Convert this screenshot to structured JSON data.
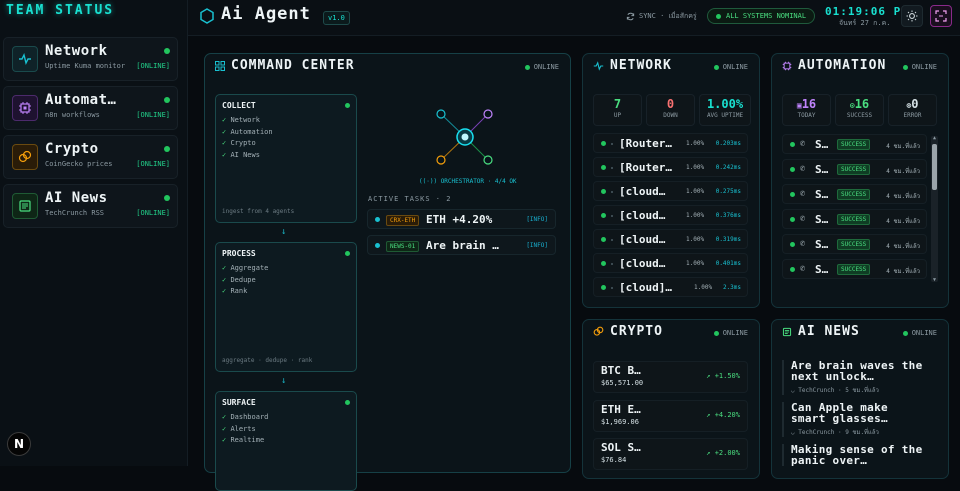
{
  "sidebar": {
    "title": "TEAM STATUS",
    "agents": [
      {
        "name": "Network",
        "sub": "Uptime Kuma monitor",
        "status": "[ONLINE]",
        "icon": "pulse-icon",
        "color": "#19b0c0"
      },
      {
        "name": "Automat…",
        "sub": "n8n workflows",
        "status": "[ONLINE]",
        "icon": "chip-icon",
        "color": "#a855f7"
      },
      {
        "name": "Crypto",
        "sub": "CoinGecko prices",
        "status": "[ONLINE]",
        "icon": "coins-icon",
        "color": "#f59e0b"
      },
      {
        "name": "AI News",
        "sub": "TechCrunch RSS",
        "status": "[ONLINE]",
        "icon": "newspaper-icon",
        "color": "#22c55e"
      }
    ],
    "footer_letter": "N"
  },
  "header": {
    "title": "Ai Agent",
    "version": "v1.0",
    "sync": "SYNC · เมื่อสักครู่",
    "system": "ALL SYSTEMS NOMINAL",
    "time": "01:19:06 PM",
    "date": "จันทร์ 27 ก.ค."
  },
  "command": {
    "title": "COMMAND CENTER",
    "status": "ONLINE",
    "stages": [
      {
        "title": "COLLECT",
        "items": [
          "Network",
          "Automation",
          "Crypto",
          "AI News"
        ],
        "footer": "ingest from 4 agents"
      },
      {
        "title": "PROCESS",
        "items": [
          "Aggregate",
          "Dedupe",
          "Rank"
        ],
        "footer": "aggregate · dedupe · rank"
      },
      {
        "title": "SURFACE",
        "items": [
          "Dashboard",
          "Alerts",
          "Realtime"
        ],
        "footer": ""
      }
    ],
    "orchestrator": "ORCHESTRATOR · 4/4 OK",
    "active_label": "ACTIVE TASKS · 2",
    "tasks": [
      {
        "tag": "CRX-ETH",
        "name": "ETH +4.20%",
        "info": "[INFO]",
        "tag_color": "#f59e0b"
      },
      {
        "tag": "NEWS-01",
        "name": "Are brain …",
        "info": "[INFO]",
        "tag_color": "#22c55e"
      }
    ]
  },
  "network": {
    "title": "NETWORK",
    "status": "ONLINE",
    "stats": [
      {
        "value": "7",
        "label": "UP",
        "color": "#4ade80"
      },
      {
        "value": "0",
        "label": "DOWN",
        "color": "#f87171"
      },
      {
        "value": "1.00%",
        "label": "AVG UPTIME",
        "color": "#19e0d0"
      }
    ],
    "rows": [
      {
        "name": "[Router…",
        "uptime": "1.00%",
        "ms": "0.203ms"
      },
      {
        "name": "[Router…",
        "uptime": "1.00%",
        "ms": "0.242ms"
      },
      {
        "name": "[cloud…",
        "uptime": "1.00%",
        "ms": "0.275ms"
      },
      {
        "name": "[cloud…",
        "uptime": "1.00%",
        "ms": "0.376ms"
      },
      {
        "name": "[cloud…",
        "uptime": "1.00%",
        "ms": "0.319ms"
      },
      {
        "name": "[cloud…",
        "uptime": "1.00%",
        "ms": "0.401ms"
      },
      {
        "name": "[cloud]…",
        "uptime": "1.00%",
        "ms": "2.3ms"
      }
    ]
  },
  "automation": {
    "title": "AUTOMATION",
    "status": "ONLINE",
    "stats": [
      {
        "value": "16",
        "label": "TODAY",
        "color": "#c084fc"
      },
      {
        "value": "16",
        "label": "SUCCESS",
        "color": "#4ade80"
      },
      {
        "value": "0",
        "label": "ERROR",
        "color": "#d6e2e6"
      }
    ],
    "rows": [
      {
        "name": "S…",
        "status": "SUCCESS",
        "ago": "4 ชม.ที่แล้ว"
      },
      {
        "name": "S…",
        "status": "SUCCESS",
        "ago": "4 ชม.ที่แล้ว"
      },
      {
        "name": "S…",
        "status": "SUCCESS",
        "ago": "4 ชม.ที่แล้ว"
      },
      {
        "name": "S…",
        "status": "SUCCESS",
        "ago": "4 ชม.ที่แล้ว"
      },
      {
        "name": "S…",
        "status": "SUCCESS",
        "ago": "4 ชม.ที่แล้ว"
      },
      {
        "name": "S…",
        "status": "SUCCESS",
        "ago": "4 ชม.ที่แล้ว"
      }
    ]
  },
  "crypto": {
    "title": "CRYPTO",
    "status": "ONLINE",
    "rows": [
      {
        "sym": "BTC B…",
        "price": "$65,571.00",
        "change": "+1.50%"
      },
      {
        "sym": "ETH E…",
        "price": "$1,969.06",
        "change": "+4.20%"
      },
      {
        "sym": "SOL S…",
        "price": "$76.84",
        "change": "+2.00%"
      }
    ]
  },
  "news": {
    "title": "AI NEWS",
    "status": "ONLINE",
    "items": [
      {
        "headline": "Are brain waves the next unlock…",
        "source": "TechCrunch · 5 ชม.ที่แล้ว"
      },
      {
        "headline": "Can Apple make smart glasses…",
        "source": "TechCrunch · 9 ชม.ที่แล้ว"
      },
      {
        "headline": "Making sense of the panic over…",
        "source": ""
      }
    ]
  }
}
